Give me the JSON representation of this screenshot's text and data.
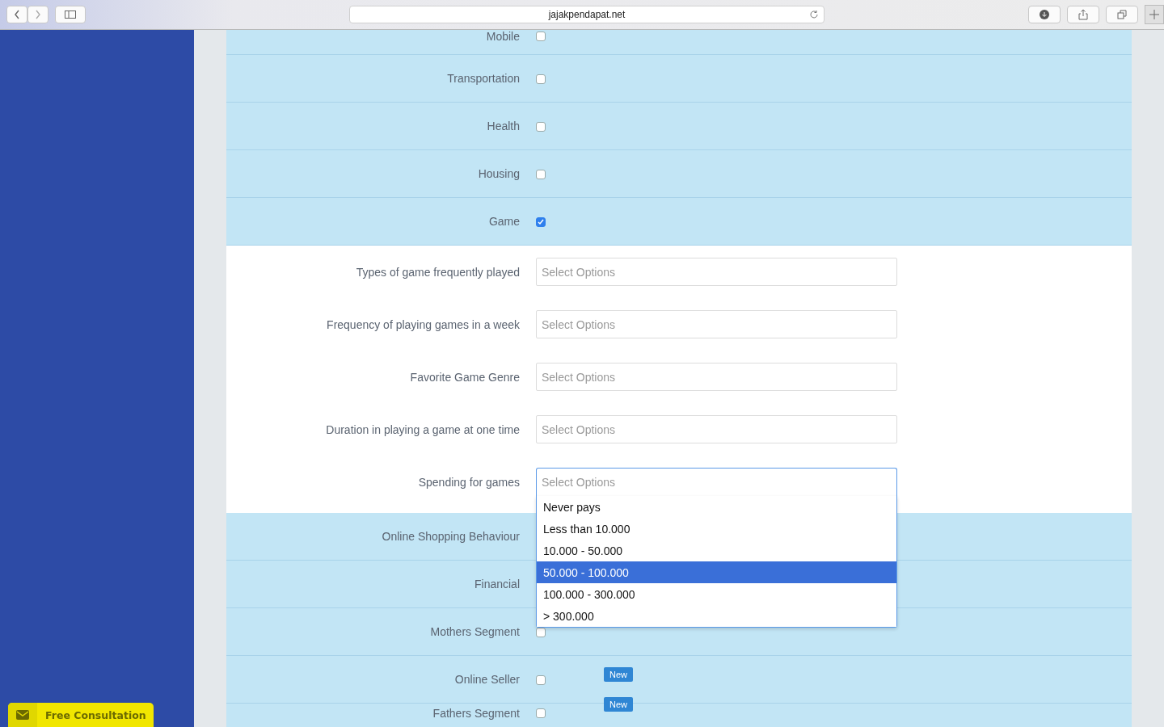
{
  "browser": {
    "url": "jajakpendapat.net"
  },
  "sidebar": {
    "cta": "Free Consultation"
  },
  "form": [
    {
      "kind": "checkbox",
      "label": "Mobile",
      "checked": false
    },
    {
      "kind": "checkbox",
      "label": "Transportation",
      "checked": false
    },
    {
      "kind": "checkbox",
      "label": "Health",
      "checked": false
    },
    {
      "kind": "checkbox",
      "label": "Housing",
      "checked": false
    },
    {
      "kind": "checkbox",
      "label": "Game",
      "checked": true
    },
    {
      "kind": "select",
      "label": "Types of game frequently played",
      "placeholder": "Select Options",
      "expanded": false
    },
    {
      "kind": "select",
      "label": "Frequency of playing games in a week",
      "placeholder": "Select Options",
      "expanded": false
    },
    {
      "kind": "select",
      "label": "Favorite Game Genre",
      "placeholder": "Select Options",
      "expanded": false
    },
    {
      "kind": "select",
      "label": "Duration in playing a game at one time",
      "placeholder": "Select Options",
      "expanded": false
    },
    {
      "kind": "select",
      "label": "Spending for games",
      "placeholder": "Select Options",
      "expanded": true,
      "options": [
        {
          "label": "Never pays",
          "selected": false
        },
        {
          "label": "Less than 10.000",
          "selected": false
        },
        {
          "label": "10.000 - 50.000",
          "selected": false
        },
        {
          "label": "50.000 - 100.000",
          "selected": true
        },
        {
          "label": "100.000 - 300.000",
          "selected": false
        },
        {
          "label": "> 300.000",
          "selected": false
        }
      ]
    },
    {
      "kind": "checkbox",
      "label": "Online Shopping Behaviour"
    },
    {
      "kind": "checkbox",
      "label": "Financial"
    },
    {
      "kind": "checkbox",
      "label": "Mothers Segment",
      "checked": false
    },
    {
      "kind": "checkbox",
      "label": "Online Seller",
      "checked": false,
      "badge": "New"
    },
    {
      "kind": "checkbox",
      "label": "Fathers Segment",
      "checked": false,
      "badge": "New"
    }
  ]
}
